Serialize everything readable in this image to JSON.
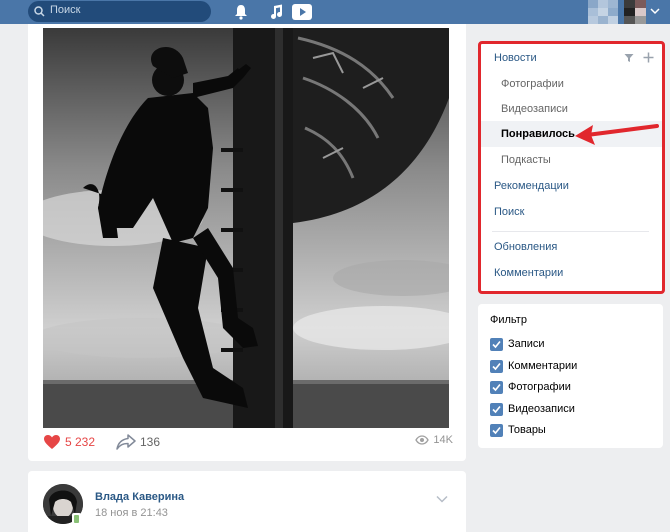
{
  "topbar": {
    "search_placeholder": "Поиск",
    "icons": [
      "search-icon",
      "bell-icon",
      "music-icon",
      "play-icon",
      "chevron-down-icon"
    ],
    "accent": "#4a76a8"
  },
  "post": {
    "likes": "5 232",
    "shares": "136",
    "views": "14K"
  },
  "post2": {
    "author": "Влада Каверина",
    "date": "18 ноя в 21:43"
  },
  "menu": {
    "items": [
      {
        "label": "Новости",
        "level": "main"
      },
      {
        "label": "Фотографии",
        "level": "sub"
      },
      {
        "label": "Видеозаписи",
        "level": "sub"
      },
      {
        "label": "Понравилось",
        "level": "sub",
        "active": true
      },
      {
        "label": "Подкасты",
        "level": "sub"
      },
      {
        "label": "Рекомендации",
        "level": "main"
      },
      {
        "label": "Поиск",
        "level": "main"
      },
      {
        "label": "Обновления",
        "level": "main"
      },
      {
        "label": "Комментарии",
        "level": "main"
      }
    ],
    "highlight_color": "#e1272d"
  },
  "filter": {
    "title": "Фильтр",
    "options": [
      {
        "label": "Записи",
        "checked": true
      },
      {
        "label": "Комментарии",
        "checked": true
      },
      {
        "label": "Фотографии",
        "checked": true
      },
      {
        "label": "Видеозаписи",
        "checked": true
      },
      {
        "label": "Товары",
        "checked": true
      }
    ]
  }
}
